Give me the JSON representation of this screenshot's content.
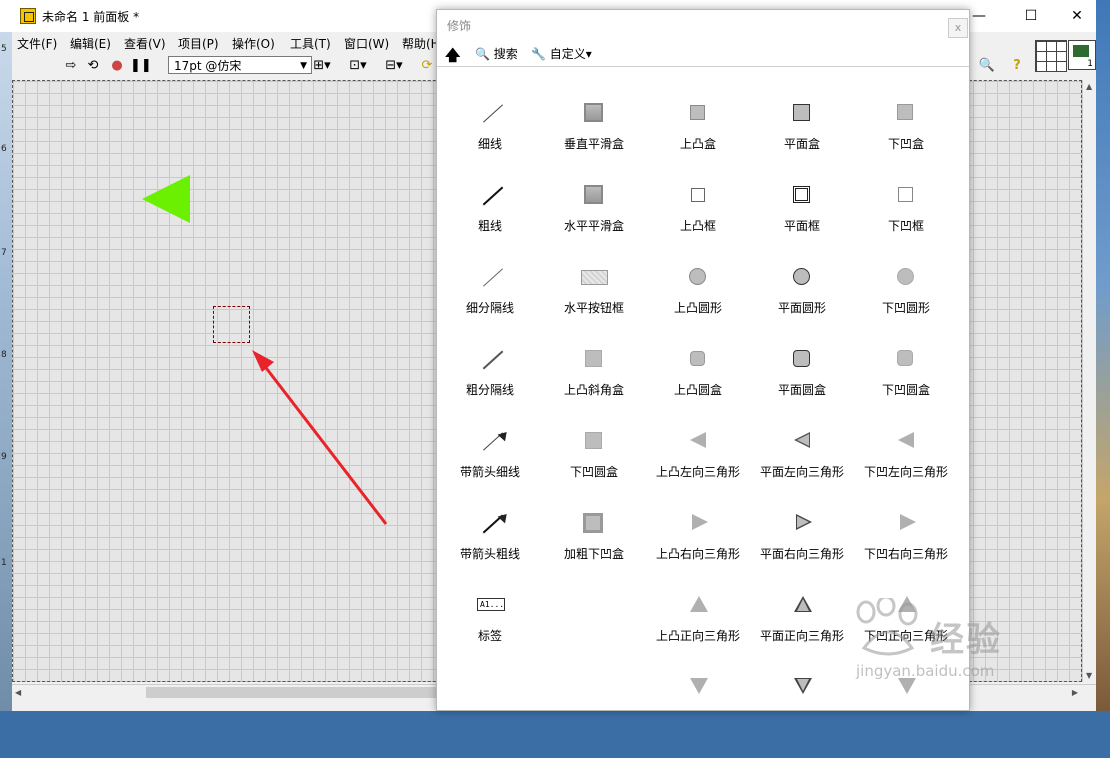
{
  "window": {
    "title": "未命名 1 前面板 *",
    "controls": {
      "minimize": "—",
      "maximize": "☐",
      "close": "✕"
    }
  },
  "menu": [
    "文件(F)",
    "编辑(E)",
    "查看(V)",
    "项目(P)",
    "操作(O)",
    "工具(T)",
    "窗口(W)",
    "帮助(H"
  ],
  "toolbar": {
    "font": "17pt @仿宋"
  },
  "left_strip_labels": [
    "5",
    "6",
    "7",
    "8",
    "9",
    "1"
  ],
  "palette": {
    "title": "修饰",
    "close": "x",
    "up_icon": "arrow-up-icon",
    "search": "搜索",
    "customize": "自定义▾",
    "items": [
      "细线",
      "垂直平滑盒",
      "上凸盒",
      "平面盒",
      "下凹盒",
      "粗线",
      "水平平滑盒",
      "上凸框",
      "平面框",
      "下凹框",
      "细分隔线",
      "水平按钮框",
      "上凸圆形",
      "平面圆形",
      "下凹圆形",
      "粗分隔线",
      "上凸斜角盒",
      "上凸圆盒",
      "平面圆盒",
      "下凹圆盒",
      "带箭头细线",
      "下凹圆盒",
      "上凸左向三角形",
      "平面左向三角形",
      "下凹左向三角形",
      "带箭头粗线",
      "加粗下凹盒",
      "上凸右向三角形",
      "平面右向三角形",
      "下凹右向三角形",
      "标签",
      "",
      "上凸正向三角形",
      "平面正向三角形",
      "下凹正向三角形"
    ],
    "label_glyph_text": "A1..."
  },
  "colors": {
    "triangle": "#6af000",
    "arrow": "#e8232a",
    "selection": "#7a0000"
  },
  "watermark": {
    "text": "经验",
    "url": "jingyan.baidu.com"
  }
}
